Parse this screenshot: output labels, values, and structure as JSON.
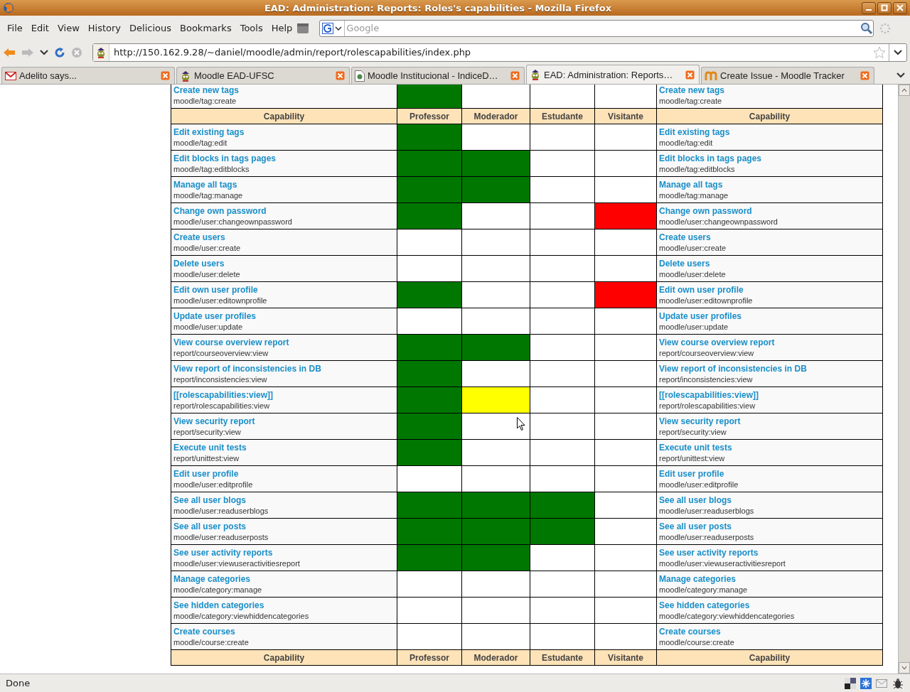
{
  "window": {
    "title": "EAD: Administration: Reports: Roles's capabilities - Mozilla Firefox"
  },
  "menu": [
    {
      "label": "File"
    },
    {
      "label": "Edit"
    },
    {
      "label": "View"
    },
    {
      "label": "History"
    },
    {
      "label": "Delicious"
    },
    {
      "label": "Bookmarks"
    },
    {
      "label": "Tools"
    },
    {
      "label": "Help"
    }
  ],
  "search": {
    "placeholder": "Google"
  },
  "navigation": {
    "back_disabled": false,
    "forward_disabled": true,
    "stop_disabled": true,
    "url": "http://150.162.9.28/~daniel/moodle/admin/report/rolescapabilities/index.php"
  },
  "tabs": [
    {
      "title": "Adelito says...",
      "selected": false
    },
    {
      "title": "Moodle EAD-UFSC",
      "selected": false
    },
    {
      "title": "Moodle Institucional - IndiceD…",
      "selected": false
    },
    {
      "title": "EAD: Administration: Reports…",
      "selected": true
    },
    {
      "title": "Create Issue - Moodle Tracker",
      "selected": false
    }
  ],
  "table": {
    "rows": [
      {
        "kind": "capability",
        "name": "Create new tags",
        "path": "moodle/tag:create",
        "perms": [
          {
            "color": "#007700"
          },
          {
            "color": "#ffffff"
          },
          {
            "color": "#ffffff"
          },
          {
            "color": "#ffffff"
          }
        ],
        "right_name": "Create new tags",
        "right_path": "moodle/tag:create"
      },
      {
        "kind": "header",
        "cells": [
          "Capability",
          "Professor",
          "Moderador",
          "Estudante",
          "Visitante",
          "Capability"
        ]
      },
      {
        "kind": "capability",
        "name": "Edit existing tags",
        "path": "moodle/tag:edit",
        "perms": [
          {
            "color": "#007700"
          },
          {
            "color": "#ffffff"
          },
          {
            "color": "#ffffff"
          },
          {
            "color": "#ffffff"
          }
        ],
        "right_name": "Edit existing tags",
        "right_path": "moodle/tag:edit"
      },
      {
        "kind": "capability",
        "name": "Edit blocks in tags pages",
        "path": "moodle/tag:editblocks",
        "perms": [
          {
            "color": "#007700"
          },
          {
            "color": "#007700"
          },
          {
            "color": "#ffffff"
          },
          {
            "color": "#ffffff"
          }
        ],
        "right_name": "Edit blocks in tags pages",
        "right_path": "moodle/tag:editblocks"
      },
      {
        "kind": "capability",
        "name": "Manage all tags",
        "path": "moodle/tag:manage",
        "perms": [
          {
            "color": "#007700"
          },
          {
            "color": "#007700"
          },
          {
            "color": "#ffffff"
          },
          {
            "color": "#ffffff"
          }
        ],
        "right_name": "Manage all tags",
        "right_path": "moodle/tag:manage"
      },
      {
        "kind": "capability",
        "name": "Change own password",
        "path": "moodle/user:changeownpassword",
        "perms": [
          {
            "color": "#007700"
          },
          {
            "color": "#ffffff"
          },
          {
            "color": "#ffffff"
          },
          {
            "color": "#ff0000"
          }
        ],
        "right_name": "Change own password",
        "right_path": "moodle/user:changeownpassword"
      },
      {
        "kind": "capability",
        "name": "Create users",
        "path": "moodle/user:create",
        "perms": [
          {
            "color": "#ffffff"
          },
          {
            "color": "#ffffff"
          },
          {
            "color": "#ffffff"
          },
          {
            "color": "#ffffff"
          }
        ],
        "right_name": "Create users",
        "right_path": "moodle/user:create"
      },
      {
        "kind": "capability",
        "name": "Delete users",
        "path": "moodle/user:delete",
        "perms": [
          {
            "color": "#ffffff"
          },
          {
            "color": "#ffffff"
          },
          {
            "color": "#ffffff"
          },
          {
            "color": "#ffffff"
          }
        ],
        "right_name": "Delete users",
        "right_path": "moodle/user:delete"
      },
      {
        "kind": "capability",
        "name": "Edit own user profile",
        "path": "moodle/user:editownprofile",
        "perms": [
          {
            "color": "#007700"
          },
          {
            "color": "#ffffff"
          },
          {
            "color": "#ffffff"
          },
          {
            "color": "#ff0000"
          }
        ],
        "right_name": "Edit own user profile",
        "right_path": "moodle/user:editownprofile"
      },
      {
        "kind": "capability",
        "name": "Update user profiles",
        "path": "moodle/user:update",
        "perms": [
          {
            "color": "#ffffff"
          },
          {
            "color": "#ffffff"
          },
          {
            "color": "#ffffff"
          },
          {
            "color": "#ffffff"
          }
        ],
        "right_name": "Update user profiles",
        "right_path": "moodle/user:update"
      },
      {
        "kind": "capability",
        "name": "View course overview report",
        "path": "report/courseoverview:view",
        "perms": [
          {
            "color": "#007700"
          },
          {
            "color": "#007700"
          },
          {
            "color": "#ffffff"
          },
          {
            "color": "#ffffff"
          }
        ],
        "right_name": "View course overview report",
        "right_path": "report/courseoverview:view"
      },
      {
        "kind": "capability",
        "name": "View report of inconsistencies in DB",
        "path": "report/inconsistencies:view",
        "perms": [
          {
            "color": "#007700"
          },
          {
            "color": "#ffffff"
          },
          {
            "color": "#ffffff"
          },
          {
            "color": "#ffffff"
          }
        ],
        "right_name": "View report of inconsistencies in DB",
        "right_path": "report/inconsistencies:view"
      },
      {
        "kind": "capability",
        "name": "[[rolescapabilities:view]]",
        "path": "report/rolescapabilities:view",
        "perms": [
          {
            "color": "#007700"
          },
          {
            "color": "#ffff00"
          },
          {
            "color": "#ffffff"
          },
          {
            "color": "#ffffff"
          }
        ],
        "right_name": "[[rolescapabilities:view]]",
        "right_path": "report/rolescapabilities:view"
      },
      {
        "kind": "capability",
        "name": "View security report",
        "path": "report/security:view",
        "perms": [
          {
            "color": "#007700"
          },
          {
            "color": "#ffffff"
          },
          {
            "color": "#ffffff"
          },
          {
            "color": "#ffffff"
          }
        ],
        "right_name": "View security report",
        "right_path": "report/security:view"
      },
      {
        "kind": "capability",
        "name": "Execute unit tests",
        "path": "report/unittest:view",
        "perms": [
          {
            "color": "#007700"
          },
          {
            "color": "#ffffff"
          },
          {
            "color": "#ffffff"
          },
          {
            "color": "#ffffff"
          }
        ],
        "right_name": "Execute unit tests",
        "right_path": "report/unittest:view"
      },
      {
        "kind": "capability",
        "name": "Edit user profile",
        "path": "moodle/user:editprofile",
        "perms": [
          {
            "color": "#ffffff"
          },
          {
            "color": "#ffffff"
          },
          {
            "color": "#ffffff"
          },
          {
            "color": "#ffffff"
          }
        ],
        "right_name": "Edit user profile",
        "right_path": "moodle/user:editprofile"
      },
      {
        "kind": "capability",
        "name": "See all user blogs",
        "path": "moodle/user:readuserblogs",
        "perms": [
          {
            "color": "#007700"
          },
          {
            "color": "#007700"
          },
          {
            "color": "#007700"
          },
          {
            "color": "#ffffff"
          }
        ],
        "right_name": "See all user blogs",
        "right_path": "moodle/user:readuserblogs"
      },
      {
        "kind": "capability",
        "name": "See all user posts",
        "path": "moodle/user:readuserposts",
        "perms": [
          {
            "color": "#007700"
          },
          {
            "color": "#007700"
          },
          {
            "color": "#007700"
          },
          {
            "color": "#ffffff"
          }
        ],
        "right_name": "See all user posts",
        "right_path": "moodle/user:readuserposts"
      },
      {
        "kind": "capability",
        "name": "See user activity reports",
        "path": "moodle/user:viewuseractivitiesreport",
        "perms": [
          {
            "color": "#007700"
          },
          {
            "color": "#007700"
          },
          {
            "color": "#ffffff"
          },
          {
            "color": "#ffffff"
          }
        ],
        "right_name": "See user activity reports",
        "right_path": "moodle/user:viewuseractivitiesreport"
      },
      {
        "kind": "capability",
        "name": "Manage categories",
        "path": "moodle/category:manage",
        "perms": [
          {
            "color": "#ffffff"
          },
          {
            "color": "#ffffff"
          },
          {
            "color": "#ffffff"
          },
          {
            "color": "#ffffff"
          }
        ],
        "right_name": "Manage categories",
        "right_path": "moodle/category:manage"
      },
      {
        "kind": "capability",
        "name": "See hidden categories",
        "path": "moodle/category:viewhiddencategories",
        "perms": [
          {
            "color": "#ffffff"
          },
          {
            "color": "#ffffff"
          },
          {
            "color": "#ffffff"
          },
          {
            "color": "#ffffff"
          }
        ],
        "right_name": "See hidden categories",
        "right_path": "moodle/category:viewhiddencategories"
      },
      {
        "kind": "capability",
        "name": "Create courses",
        "path": "moodle/course:create",
        "perms": [
          {
            "color": "#ffffff"
          },
          {
            "color": "#ffffff"
          },
          {
            "color": "#ffffff"
          },
          {
            "color": "#ffffff"
          }
        ],
        "right_name": "Create courses",
        "right_path": "moodle/course:create"
      },
      {
        "kind": "header",
        "cells": [
          "Capability",
          "Professor",
          "Moderador",
          "Estudante",
          "Visitante",
          "Capability"
        ]
      }
    ]
  },
  "status_bar": {
    "text": "Done"
  }
}
